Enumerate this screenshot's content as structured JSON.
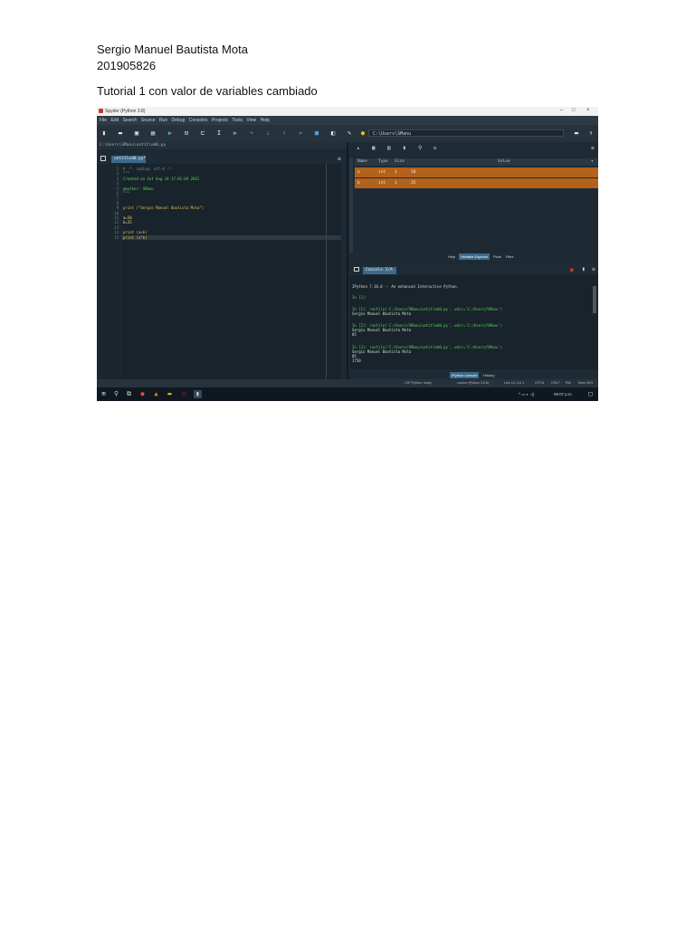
{
  "document": {
    "author": "Sergio Manuel Bautista Mota",
    "student_id": "201905826",
    "heading": "Tutorial 1 con valor de variables cambiado"
  },
  "window": {
    "title": "Spyder (Python 3.8)",
    "controls": [
      "–",
      "□",
      "×"
    ]
  },
  "menu": [
    "File",
    "Edit",
    "Search",
    "Source",
    "Run",
    "Debug",
    "Consoles",
    "Projects",
    "Tools",
    "View",
    "Help"
  ],
  "toolbar": {
    "path": "C:\\Users\\SManu"
  },
  "editor": {
    "breadcrumb": "C:\\Users\\SManu\\untitled0.py",
    "tab": "untitled0.py* ×",
    "line_numbers": [
      "1",
      "2",
      "3",
      "4",
      "5",
      "6",
      "7",
      "8",
      "9",
      "10",
      "11",
      "12",
      "13",
      "14",
      "15"
    ],
    "lines": [
      "# -*- coding: utf-8 -*-",
      "\"\"\"",
      "Created on Sat Aug 14 17:01:04 2021",
      "",
      "@author: SManu",
      "\"\"\"",
      "",
      "",
      "print (\"Sergio Manuel Bautista Mota\")",
      "",
      "a=50",
      "b=35",
      "",
      "print (a+b)",
      "print (a*b)"
    ]
  },
  "variable_explorer": {
    "headers": [
      "Name",
      "Type",
      "Size",
      "Value"
    ],
    "rows": [
      {
        "name": "a",
        "type": "int",
        "size": "1",
        "value": "50"
      },
      {
        "name": "b",
        "type": "int",
        "size": "1",
        "value": "35"
      }
    ],
    "tabs": [
      "Help",
      "Variable Explorer",
      "Plots",
      "Files"
    ],
    "active_tab": "Variable Explorer"
  },
  "console": {
    "tab": "Console 1/A ×",
    "lines": [
      {
        "text": "IPython 7.16.0 -- An enhanced Interactive Python.",
        "color": "#d7dde1"
      },
      {
        "text": "In [1]:",
        "color": "#5fd35f"
      },
      {
        "text": "In [1]: runfile('C:/Users/SManu/untitled0.py', wdir='C:/Users/SManu')",
        "color": "#5fd35f"
      },
      {
        "text": "Sergio Manuel Bautista Mota",
        "color": "#d7dde1"
      },
      {
        "text": "In [2]: runfile('C:/Users/SManu/untitled0.py', wdir='C:/Users/SManu')",
        "color": "#5fd35f"
      },
      {
        "text": "Sergio Manuel Bautista Mota",
        "color": "#d7dde1"
      },
      {
        "text": "85",
        "color": "#d7dde1"
      },
      {
        "text": "In [3]: runfile('C:/Users/SManu/untitled0.py', wdir='C:/Users/SManu')",
        "color": "#5fd35f"
      },
      {
        "text": "Sergio Manuel Bautista Mota",
        "color": "#d7dde1"
      },
      {
        "text": "85",
        "color": "#d7dde1"
      },
      {
        "text": "1750",
        "color": "#d7dde1"
      }
    ],
    "tabs": [
      "IPython console",
      "History"
    ],
    "active_tab": "IPython console"
  },
  "status": {
    "lsp": "LSP Python: ready",
    "env": "custom (Python 3.8.8)",
    "position": "Line 15, Col 1",
    "encoding": "UTF-8",
    "eol": "CRLF",
    "mode": "RW",
    "mem": "Mem 54%"
  },
  "taskbar": {
    "clock": "09:07 p.m."
  },
  "colors": {
    "accent": "#3b6a8c",
    "variable_row": "#b3621b",
    "prompt_green": "#5fd35f",
    "background": "#19232b"
  }
}
